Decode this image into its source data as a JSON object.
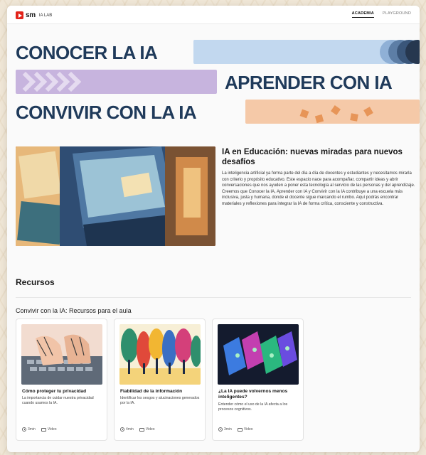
{
  "nav": {
    "logo_sm": "sm",
    "logo_lab": "IA LAB",
    "links": [
      {
        "label": "ACADEMIA",
        "active": true
      },
      {
        "label": "PLAYGROUND",
        "active": false
      }
    ]
  },
  "hero": {
    "line1": "CONOCER LA IA",
    "line2": "APRENDER CON IA",
    "line3": "CONVIVIR CON LA IA"
  },
  "intro": {
    "title": "IA en Educación: nuevas miradas para nuevos desafíos",
    "body": "La inteligencia artificial ya forma parte del día a día de docentes y estudiantes y necesitamos mirarla con criterio y propósito educativo. Este espacio nace para acompañar, compartir ideas y abrir conversaciones que nos ayuden a poner esta tecnología al servicio de las personas y del aprendizaje. Creemos que Conocer la IA, Aprender con IA y Convivir con la IA contribuye a una escuela más inclusiva, justa y humana, donde el docente sigue marcando el rumbo. Aquí podrás encontrar materiales y reflexiones para integrar la IA de forma crítica, consciente y constructiva."
  },
  "resources": {
    "heading": "Recursos",
    "section_title": "Convivir con la IA: Recursos para el aula",
    "cards": [
      {
        "title": "Cómo proteger tu privacidad",
        "desc": "La importancia de cuidar nuestra privacidad cuando usamos la IA.",
        "duration": "3min",
        "type": "Video"
      },
      {
        "title": "Fiabilidad de la información",
        "desc": "Identificar los sesgos y alucinaciones generados por la IA.",
        "duration": "4min",
        "type": "Video"
      },
      {
        "title": "¿La IA puede volvernos menos inteligentes?",
        "desc": "Entender cómo el uso de la IA afecta a los procesos cognitivos.",
        "duration": "3min",
        "type": "Video"
      }
    ]
  },
  "colors": {
    "hero_text": "#1f3a5a",
    "band_blue": "#c2d8ef",
    "band_purple": "#c7b4de",
    "band_orange": "#f5c9a8",
    "logo_red": "#e2231a"
  }
}
